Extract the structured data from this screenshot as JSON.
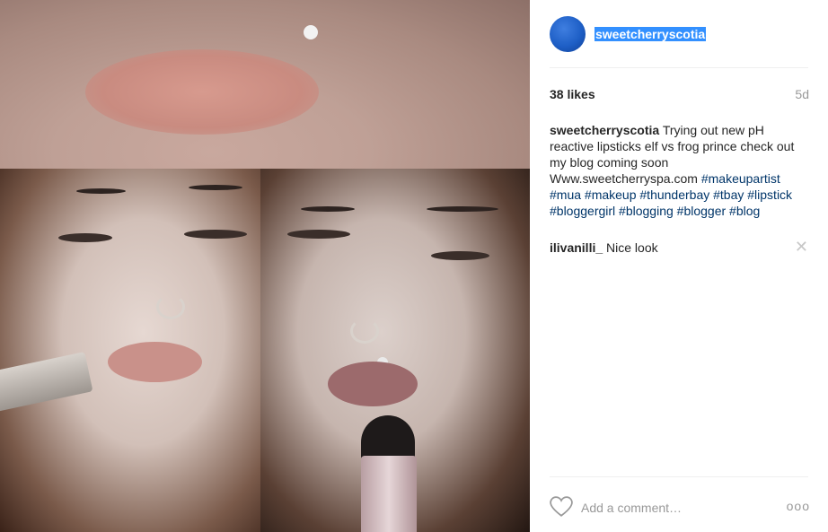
{
  "post": {
    "username": "sweetcherryscotia",
    "likes": "38 likes",
    "age": "5d",
    "caption": {
      "user": "sweetcherryscotia",
      "text": "Trying out new pH reactive lipsticks elf vs frog prince check out my blog coming soon Www.sweetcherryspa.com",
      "tags": "#makeupartist #mua #makeup #thunderbay #tbay #lipstick #bloggergirl #blogging #blogger #blog"
    },
    "comments": [
      {
        "user": "ilivanilli_",
        "text": "Nice look"
      }
    ]
  },
  "composer": {
    "placeholder": "Add a comment…",
    "more": "ooo"
  },
  "icons": {
    "heart": "heart-outline-icon",
    "close": "close-icon",
    "more": "more-options-icon"
  },
  "colors": {
    "link": "#003569",
    "selection": "#3390ff",
    "muted": "#999999",
    "text": "#262626"
  }
}
